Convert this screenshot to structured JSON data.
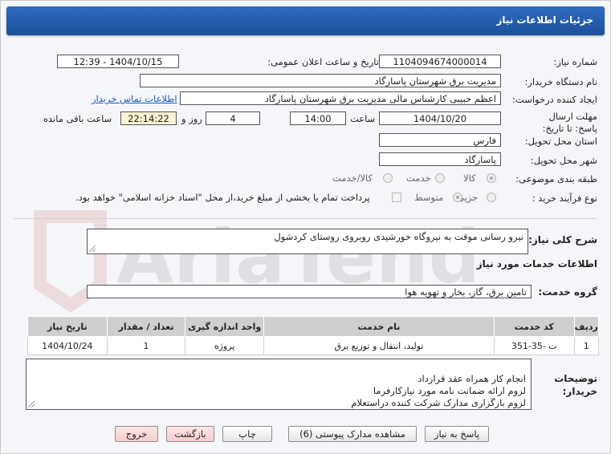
{
  "header": {
    "title": "جزئیات اطلاعات نیاز"
  },
  "form": {
    "need_number_label": "شماره نیاز:",
    "need_number": "1104094674000014",
    "announce_label": "تاریخ و ساعت اعلان عمومی:",
    "announce_value": "1404/10/15 - 12:39",
    "buyer_org_label": "نام دستگاه خریدار:",
    "buyer_org": "مدیریت برق شهرستان پاسارگاد",
    "creator_label": "ایجاد کننده درخواست:",
    "creator": "اعظم حبیبی کارشناس مالی مدیریت برق شهرستان پاسارگاد",
    "contact_link": "اطلاعات تماس خریدار",
    "deadline_label": "مهلت ارسال پاسخ: تا تاریخ:",
    "deadline_date": "1404/10/20",
    "time_label": "ساعت",
    "deadline_time": "14:00",
    "days_value": "4",
    "days_label": "روز و",
    "remaining_time": "22:14:22",
    "remaining_label": "ساعت باقی مانده",
    "province_label": "استان محل تحویل:",
    "province": "فارس",
    "city_label": "شهر محل تحویل:",
    "city": "پاسارگاد",
    "category_label": "طبقه بندی موضوعی:",
    "category_options": [
      "کالا",
      "خدمت",
      "کالا/خدمت"
    ],
    "process_label": "نوع فرآیند خرید :",
    "process_options": [
      "جزیی",
      "متوسط"
    ],
    "payment_text": "پرداخت تمام یا بخشی از مبلغ خرید،از محل \"اسناد خزانه اسلامی\" خواهد بود."
  },
  "summary": {
    "label": "شرح کلی نیاز:",
    "value": "نیرو رسانی موقت به نیروگاه خورشیدی روبروی روستای کردشول"
  },
  "services": {
    "section_title": "اطلاعات خدمات مورد نیاز",
    "group_label": "گروه خدمت:",
    "group_value": "تامین برق، گاز، بخار و تهویه هوا",
    "columns": [
      "ردیف",
      "کد خدمت",
      "نام خدمت",
      "واحد اندازه گیری",
      "تعداد / مقدار",
      "تاریخ نیاز"
    ],
    "rows": [
      [
        "1",
        "ت -35-351",
        "تولید، انتقال و توزیع برق",
        "پروژه",
        "1",
        "1404/10/24"
      ]
    ]
  },
  "notes": {
    "label": "توضیحات خریدار:",
    "text": "انجام کار همراه عقد قرارداد\nلزوم ارائه ضمانت نامه مورد نیازکارفرما\nلزوم بارگزاری مدارک شرکت کننده دراستعلام"
  },
  "buttons": {
    "reply": "پاسخ به نیاز",
    "docs": "مشاهده مدارک پیوستی (6)",
    "print": "چاپ",
    "back": "بازگشت",
    "exit": "خروج"
  },
  "watermark": {
    "text": "AriaTender.net"
  }
}
